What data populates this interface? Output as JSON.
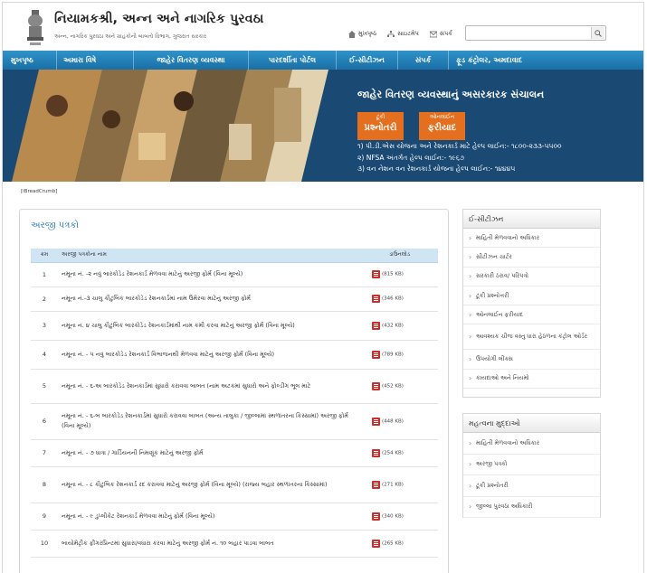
{
  "header": {
    "title": "નિયામકશ્રી, અન્ન અને નાગરિક પુરવઠા",
    "subtitle": "અન્ન, નાગરિક પુરવઠા અને ગ્રાહકોની બાબતો વિભાગ, ગુજરાત સરકાર",
    "links": {
      "home": "મુખપૃષ્ઠ",
      "sitemap": "સાઇટમેપ",
      "contact": "સંપર્ક"
    },
    "search_placeholder": ""
  },
  "nav": {
    "items": [
      "મુખપૃષ્ઠ",
      "અમારા વિષે",
      "જાહેર વિતરણ વ્યવસ્થા",
      "પારદર્શીતા પોર્ટલ",
      "ઈ-સીટીઝન",
      "સંપર્ક",
      "ફૂડ કંટ્રોલર, અમદાવાદ"
    ]
  },
  "banner": {
    "heading": "જાહેર વિતરણ વ્યવસ્થાનું અસરકારક સંચાલન",
    "button1_small": "ટૂંકી",
    "button1_big": "પ્રશ્નોતરી",
    "button2_small": "ઓનલાઈન",
    "button2_big": "ફરીયાદ",
    "helplines": [
      "૧) પી.ડી.એસ યોજના અને રેશનકાર્ડ માટે હેલ્પ લાઈન:- ૧૮૦૦-૨૩૩-૫૫૦૦",
      "૨) NFSA અંતર્ગત હેલ્પ લાઈન:- ૧૯૬૭",
      "૩) વન નેશન વન રેશનકાર્ડ યોજના હેલ્પ લાઈન:- ૧૪૪૪૫"
    ]
  },
  "breadcrumb": "[iBreadCrumb]",
  "main": {
    "title": "અરજી પત્રકો",
    "columns": [
      "ક્રમ",
      "અરજી પત્રકોના નામ",
      "ડાઉનલોડ"
    ],
    "rows": [
      {
        "num": "1",
        "title": "નમૂના નં. -૨ નવું બારકોડેડ રેશનકાર્ડ મેળવવા માટેનું અરજી ફોર્મ (વિના મૂલ્યે)",
        "size": "(815 KB)"
      },
      {
        "num": "2",
        "title": "નમૂના નં.-૩ ચાલુ કૌટુંબિક બારકોડેડ રેશનકાર્ડમાં નામ ઉમેરવા માટેનું અરજી ફોર્મ",
        "size": "(346 KB)"
      },
      {
        "num": "3",
        "title": "નમૂના નં. ૪ ચાલુ કૌટુંબિક બારકોડેડ રેશનકાર્ડમાંથી નામ કમી કરવા માટેનું અરજી ફોર્મ (વિના મૂલ્યે)",
        "size": "(432 KB)"
      },
      {
        "num": "4",
        "title": "નમૂના નં. - ૫ નવું બારકોડેડ રેશનકાર્ડ વિભાજનથી મેળવવા માટેનું અરજી ફોર્મ (વિના મૂલ્યે)",
        "size": "(789 KB)"
      },
      {
        "num": "5",
        "title": "નમૂના નં. - ૬-અ બારકોડેડ રેશનકાર્ડમાં સુધારો કરાવવા બાબત (નામ અટકમાં સુધારો અને ફોલ્ડીંગ ભૂલ માટે",
        "size": "(452 KB)"
      },
      {
        "num": "6",
        "title": "નમૂના નં. - ૬-બ બારકોડેડ રેશનકાર્ડમાં સુધારો કરાવવા બાબત (અન્ય તાલુકા / જીલ્લામાં સ્થળાંતરના કિસ્સામાં) અરજી ફોર્મ (વિના મૂલ્યે)",
        "size": "(448 KB)"
      },
      {
        "num": "7",
        "title": "નમૂના નં. - ૭ ધાત્રા / ગાર્ડિયનની નિમણૂંક માટેનું અરજી ફોર્મ",
        "size": "(254 KB)"
      },
      {
        "num": "8",
        "title": "નમૂના નં. - ૮ કૌટુંબિક રેશનકાર્ડ રદ કરાવવા માટેનું અરજી ફોર્મ (વિના મૂલ્યે) (રાજ્ય બહાર સ્થળાંતરના કિસ્સામાં)",
        "size": "(271 KB)"
      },
      {
        "num": "9",
        "title": "નમૂના નં. - ૯ ડુપ્લીકેટ રેશનકાર્ડ મેળવવા માટેનું ફોર્મ (વિના મૂલ્યે)",
        "size": "(340 KB)"
      },
      {
        "num": "10",
        "title": "બાયોમેટ્રીક ફીંગરપ્રિન્ટમાં સુધારા/વધારા કરવા માટેનું અરજી ફોર્મ નં. ૧૦ બહાર પાડવા બાબત",
        "size": "(265 KB)"
      }
    ]
  },
  "sidebar1": {
    "title": "ઈ-સીટીઝન",
    "items": [
      "માહિતી મેળવવાનો અધિકાર",
      "સીટીઝન ચાર્ટર",
      "સરકારી ઠરાવ/ પરિપત્રો",
      "ટૂંકી પ્રશ્નોત્તરી",
      "ઓનલાઈન ફરીયાદ",
      "આવશ્યક ચીજ વસ્તુ ધારા હેઠળના કંટ્રોલ ઓર્ડર",
      "ઉપયોગી લીંક્સ",
      "કાયદાઓ અને નિયમો"
    ]
  },
  "sidebar2": {
    "title": "મહત્વના મુદ્દાઓ",
    "items": [
      "માહિતી મેળવવાનો અધિકાર",
      "અરજી પત્રકો",
      "ટૂંકી પ્રશ્નોતરી",
      "જીલ્લા પુરવઠા અધિકારી"
    ]
  },
  "colors": {
    "nav": "#1f7db6",
    "banner": "#1a4a73",
    "accent_button": "#e46f1f",
    "table_header": "#cfe5f4",
    "title_blue": "#2a7bb8"
  }
}
